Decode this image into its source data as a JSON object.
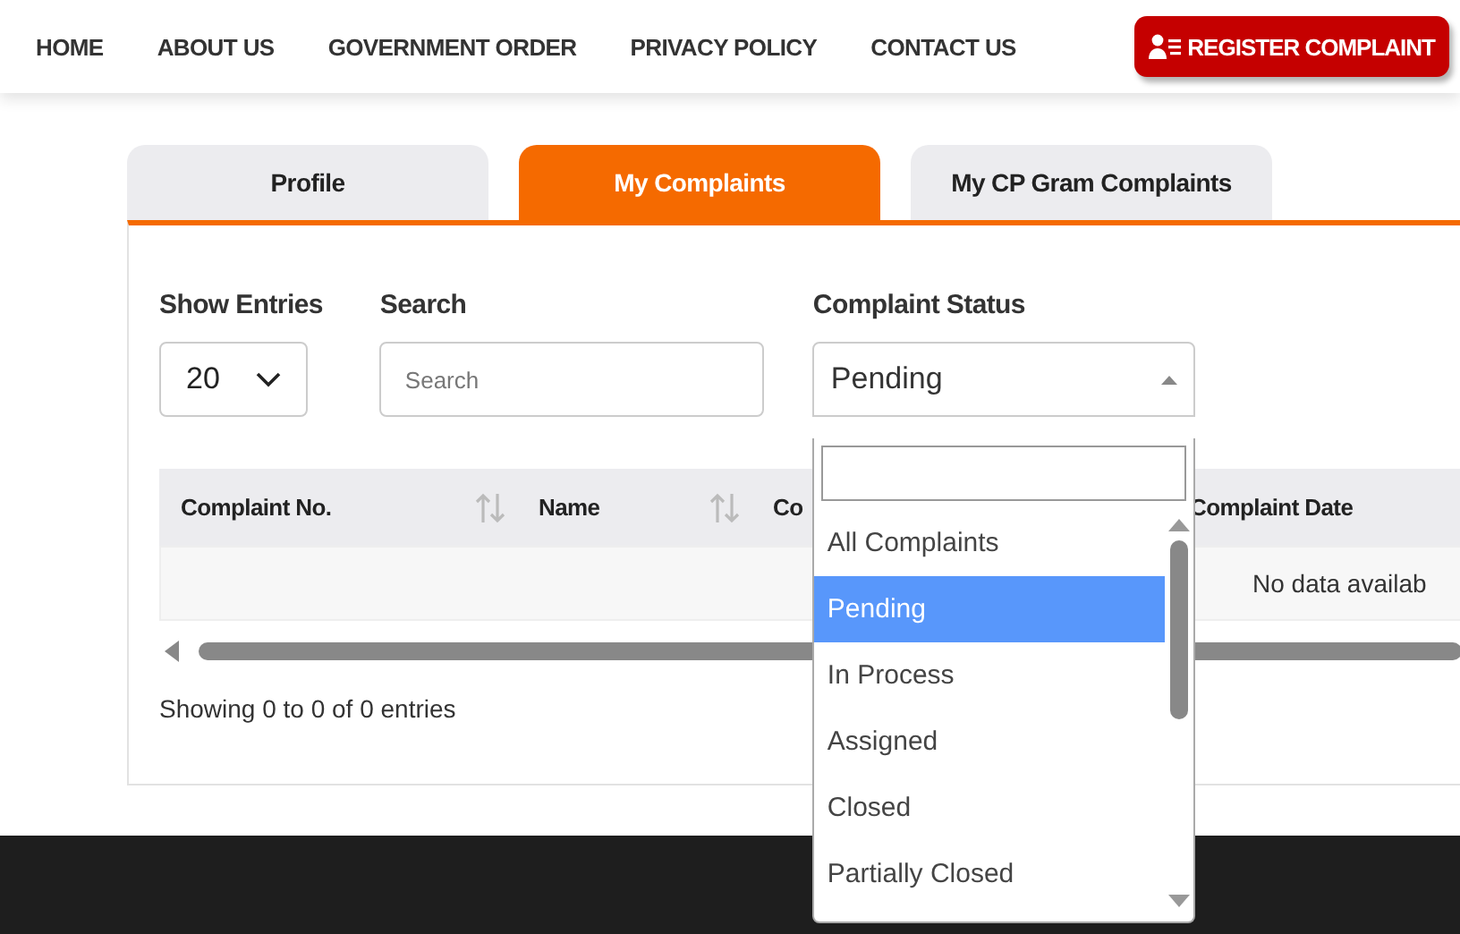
{
  "nav": {
    "links": [
      "HOME",
      "ABOUT US",
      "GOVERNMENT ORDER",
      "PRIVACY POLICY",
      "CONTACT US"
    ],
    "register_button": "REGISTER COMPLAINT"
  },
  "tabs": [
    {
      "label": "Profile",
      "selected": false
    },
    {
      "label": "My Complaints",
      "selected": true
    },
    {
      "label": "My CP Gram Complaints",
      "selected": false
    }
  ],
  "filters": {
    "show_entries": {
      "label": "Show Entries",
      "value": "20"
    },
    "search": {
      "label": "Search",
      "placeholder": "Search"
    },
    "status": {
      "label": "Complaint Status",
      "value": "Pending",
      "expanded": true,
      "options": [
        {
          "label": "All Complaints",
          "selected": false
        },
        {
          "label": "Pending",
          "selected": true
        },
        {
          "label": "In Process",
          "selected": false
        },
        {
          "label": "Assigned",
          "selected": false
        },
        {
          "label": "Closed",
          "selected": false
        },
        {
          "label": "Partially Closed",
          "selected": false
        }
      ]
    }
  },
  "table": {
    "columns": [
      {
        "label": "Complaint No.",
        "sortable": true
      },
      {
        "label": "Name",
        "sortable": true
      },
      {
        "label": "Co"
      },
      {
        "label": "Complaint Date"
      }
    ],
    "empty_message": "No data availab"
  },
  "info": "Showing 0 to 0 of 0 entries"
}
